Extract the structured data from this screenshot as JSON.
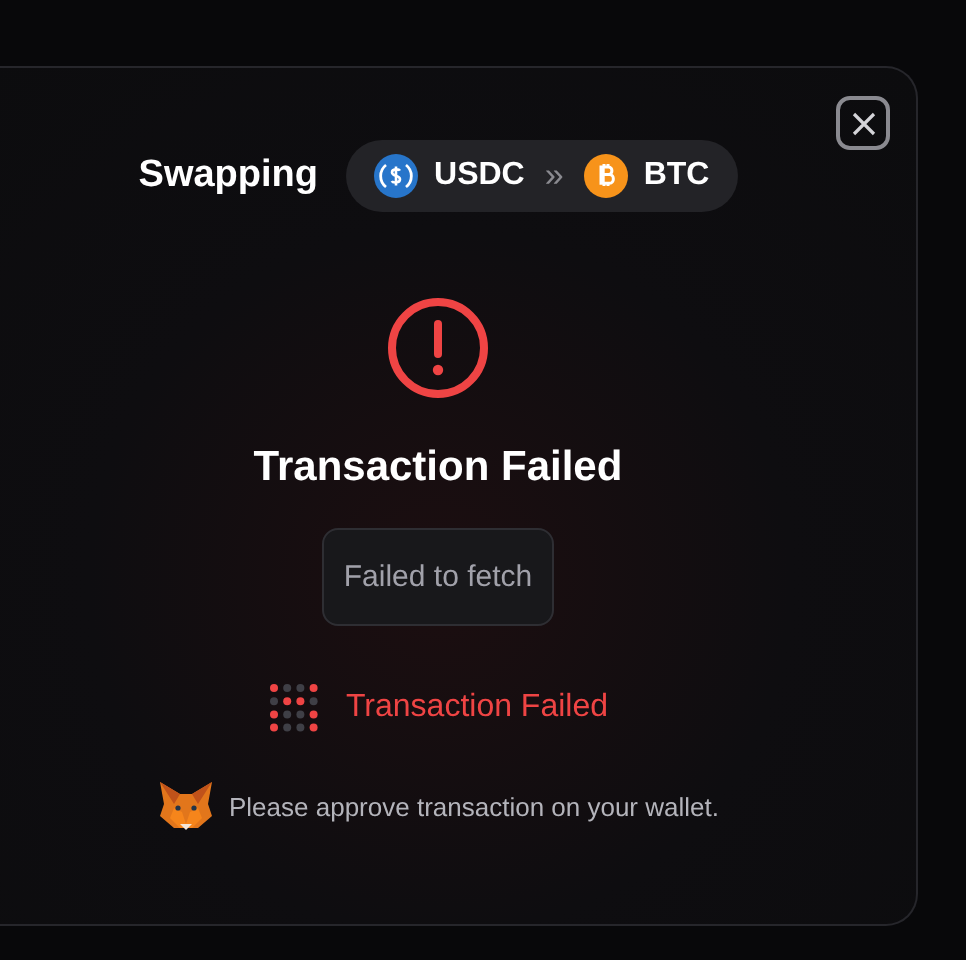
{
  "modal": {
    "title": "Swapping",
    "pair": {
      "from": "USDC",
      "separator": "»",
      "to": "BTC"
    },
    "result": {
      "failed": true,
      "heading": "Transaction Failed",
      "message": "Failed to fetch"
    },
    "progress": {
      "failed": true,
      "text": "Transaction Failed"
    },
    "wallet_hint": "Please approve transaction on your wallet."
  }
}
